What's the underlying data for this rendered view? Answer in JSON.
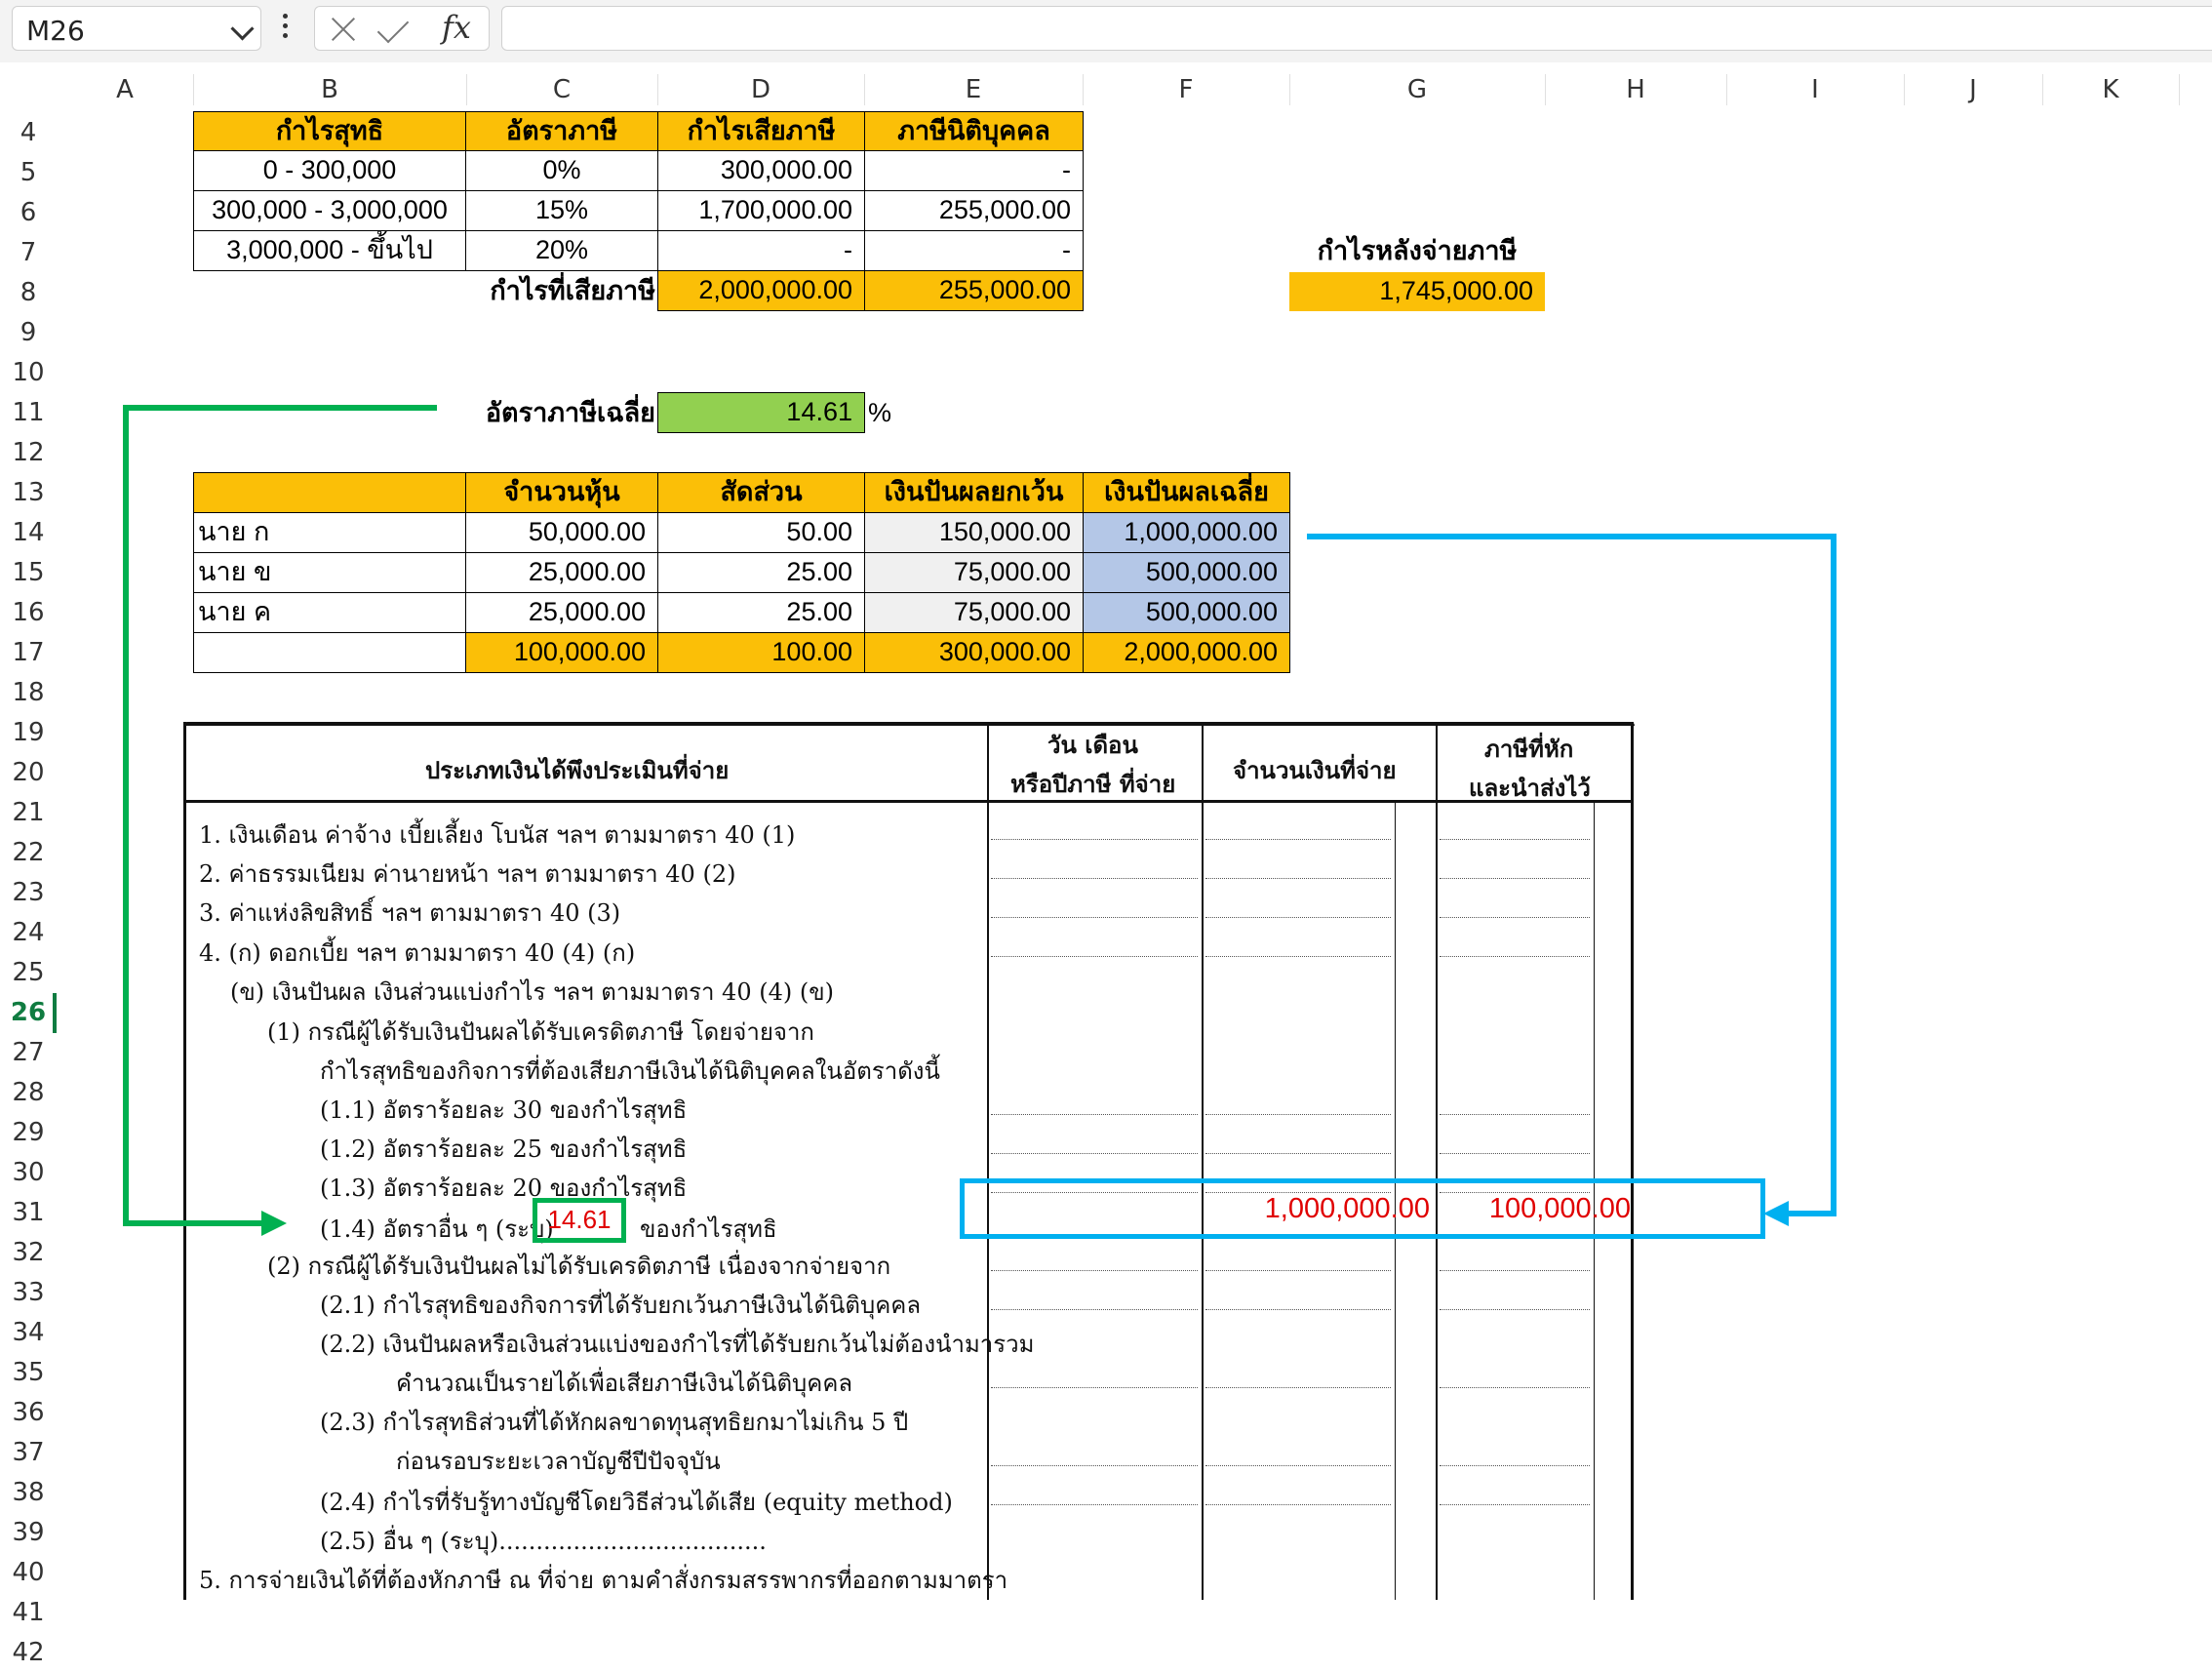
{
  "formula_bar": {
    "cell_ref": "M26",
    "formula": ""
  },
  "columns": [
    "A",
    "B",
    "C",
    "D",
    "E",
    "F",
    "G",
    "H",
    "I",
    "J",
    "K"
  ],
  "rows": [
    "4",
    "5",
    "6",
    "7",
    "8",
    "9",
    "10",
    "11",
    "12",
    "13",
    "14",
    "15",
    "16",
    "17",
    "18",
    "19",
    "20",
    "21",
    "22",
    "23",
    "24",
    "25",
    "26",
    "27",
    "28",
    "29",
    "30",
    "31",
    "32",
    "33",
    "34",
    "35",
    "36",
    "37",
    "38",
    "39",
    "40",
    "41",
    "42"
  ],
  "active_row": "26",
  "tax_table": {
    "headers": [
      "กำไรสุทธิ",
      "อัตราภาษี",
      "กำไรเสียภาษี",
      "ภาษีนิติบุคคล"
    ],
    "rows": [
      [
        "0 - 300,000",
        "0%",
        "300,000.00",
        "-"
      ],
      [
        "300,000 - 3,000,000",
        "15%",
        "1,700,000.00",
        "255,000.00"
      ],
      [
        "3,000,000 - ขึ้นไป",
        "20%",
        "-",
        "-"
      ]
    ],
    "total_label": "กำไรที่เสียภาษี",
    "total_profit": "2,000,000.00",
    "total_tax": "255,000.00"
  },
  "after_tax": {
    "label": "กำไรหลังจ่ายภาษี",
    "value": "1,745,000.00"
  },
  "avg_rate": {
    "label": "อัตราภาษีเฉลี่ย",
    "value": "14.61",
    "unit": "%"
  },
  "dividend_table": {
    "headers": [
      "",
      "จำนวนหุ้น",
      "สัดส่วน",
      "เงินปันผลยกเว้น",
      "เงินปันผลเฉลี่ย"
    ],
    "rows": [
      [
        "นาย ก",
        "50,000.00",
        "50.00",
        "150,000.00",
        "1,000,000.00"
      ],
      [
        "นาย ข",
        "25,000.00",
        "25.00",
        "75,000.00",
        "500,000.00"
      ],
      [
        "นาย ค",
        "25,000.00",
        "25.00",
        "75,000.00",
        "500,000.00"
      ]
    ],
    "totals": [
      "",
      "100,000.00",
      "100.00",
      "300,000.00",
      "2,000,000.00"
    ]
  },
  "form": {
    "headers": {
      "type": "ประเภทเงินได้พึงประเมินที่จ่าย",
      "date_1": "วัน เดือน",
      "date_2": "หรือปีภาษี ที่จ่าย",
      "amount": "จำนวนเงินที่จ่าย",
      "tax_1": "ภาษีที่หัก",
      "tax_2": "และนำส่งไว้"
    },
    "lines": [
      "1. เงินเดือน ค่าจ้าง เบี้ยเลี้ยง โบนัส ฯลฯ ตามมาตรา 40 (1)",
      "2. ค่าธรรมเนียม ค่านายหน้า ฯลฯ ตามมาตรา 40 (2)",
      "3. ค่าแห่งลิขสิทธิ์ ฯลฯ ตามมาตรา 40 (3)",
      "4. (ก) ดอกเบี้ย ฯลฯ ตามมาตรา 40 (4) (ก)",
      "(ข) เงินปันผล เงินส่วนแบ่งกำไร ฯลฯ ตามมาตรา 40 (4) (ข)",
      "(1)  กรณีผู้ได้รับเงินปันผลได้รับเครดิตภาษี   โดยจ่ายจาก",
      "กำไรสุทธิของกิจการที่ต้องเสียภาษีเงินได้นิติบุคคลในอัตราดังนี้",
      "(1.1)  อัตราร้อยละ 30   ของกำไรสุทธิ",
      "(1.2)  อัตราร้อยละ 25   ของกำไรสุทธิ",
      "(1.3)  อัตราร้อยละ 20   ของกำไรสุทธิ",
      "(1.4)  อัตราอื่น ๆ (ระบุ)",
      "(2)  กรณีผู้ได้รับเงินปันผลไม่ได้รับเครดิตภาษี   เนื่องจากจ่ายจาก",
      "(2.1)  กำไรสุทธิของกิจการที่ได้รับยกเว้นภาษีเงินได้นิติบุคคล",
      "(2.2)  เงินปันผลหรือเงินส่วนแบ่งของกำไรที่ได้รับยกเว้นไม่ต้องนำมารวม",
      "คำนวณเป็นรายได้เพื่อเสียภาษีเงินได้นิติบุคคล",
      "(2.3)  กำไรสุทธิส่วนที่ได้หักผลขาดทุนสุทธิยกมาไม่เกิน 5 ปี",
      "ก่อนรอบระยะเวลาบัญชีปีปัจจุบัน",
      "(2.4)  กำไรที่รับรู้ทางบัญชีโดยวิธีส่วนได้เสีย (equity method)",
      "(2.5)  อื่น ๆ (ระบุ)....................................",
      "5. การจ่ายเงินได้ที่ต้องหักภาษี ณ ที่จ่าย ตามคำสั่งกรมสรรพากรที่ออกตามมาตรา"
    ],
    "rate_value": "14.61",
    "rate_suffix": "ของกำไรสุทธิ",
    "amount_paid": "1,000,000.00",
    "tax_withheld": "100,000.00"
  },
  "colors": {
    "orange": "#FBBF07",
    "green": "#92D050",
    "blue": "#B4C7E7",
    "arrow_green": "#00B050",
    "arrow_blue": "#00B0F0",
    "red": "#E00000"
  }
}
